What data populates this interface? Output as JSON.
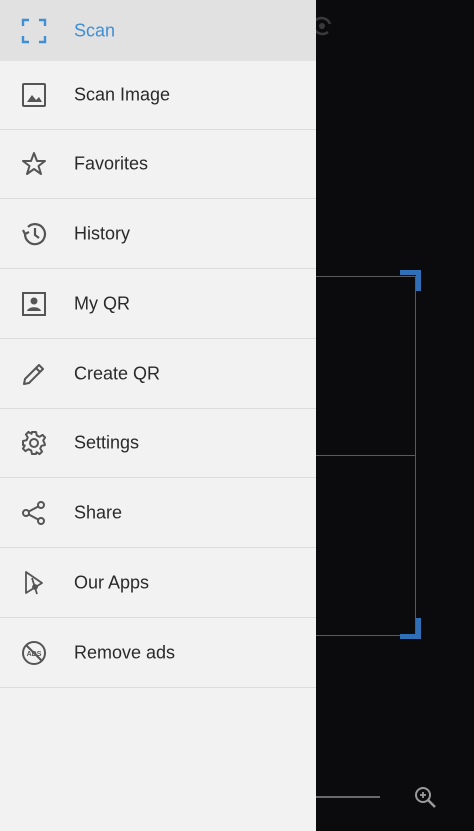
{
  "drawer": {
    "items": [
      {
        "label": "Scan",
        "icon": "scan-frame-icon",
        "active": true
      },
      {
        "label": "Scan Image",
        "icon": "image-icon"
      },
      {
        "label": "Favorites",
        "icon": "star-icon"
      },
      {
        "label": "History",
        "icon": "history-icon"
      },
      {
        "label": "My QR",
        "icon": "contact-card-icon"
      },
      {
        "label": "Create QR",
        "icon": "pencil-icon"
      },
      {
        "label": "Settings",
        "icon": "gear-icon"
      },
      {
        "label": "Share",
        "icon": "share-icon"
      },
      {
        "label": "Our Apps",
        "icon": "apps-icon"
      },
      {
        "label": "Remove ads",
        "icon": "no-ads-icon"
      }
    ]
  },
  "colors": {
    "accent": "#3f8fd6",
    "drawer_bg": "#f2f2f2",
    "active_bg": "#e1e1e1",
    "camera_bg": "#0b0a0d",
    "scan_corner": "#2f6fb8",
    "laser": "#b8332d"
  }
}
